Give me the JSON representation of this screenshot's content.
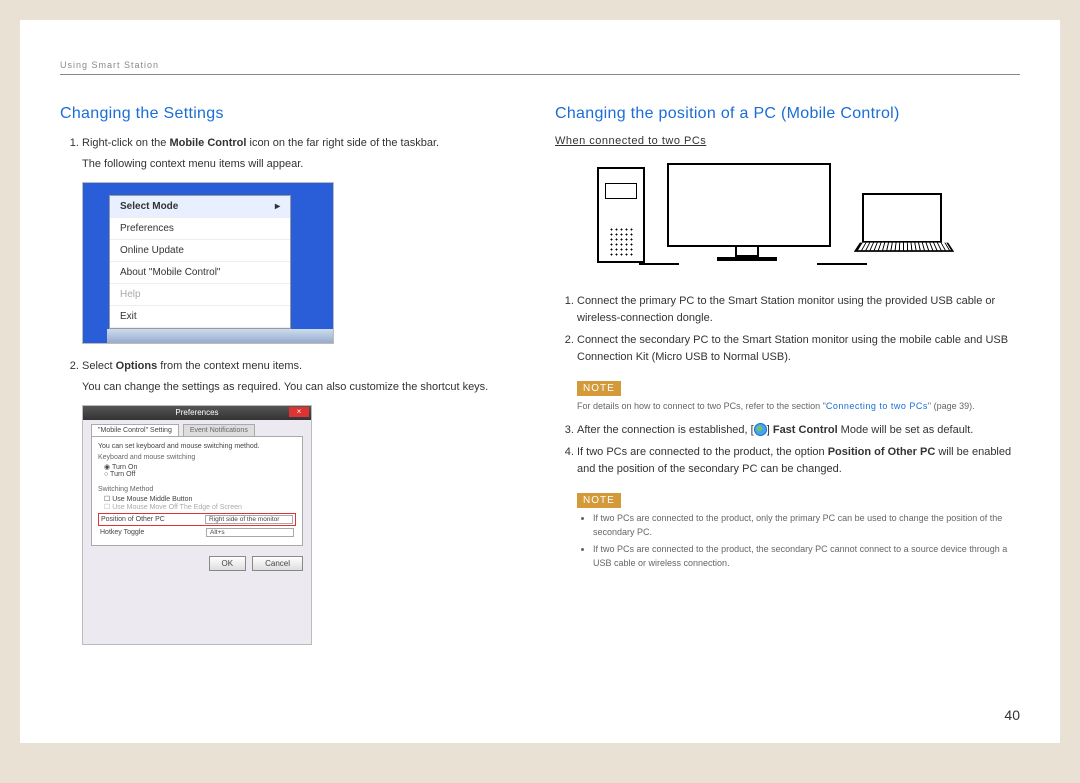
{
  "header": "Using Smart Station",
  "page_number": "40",
  "left": {
    "title": "Changing the Settings",
    "step1_pre": "Right-click on the ",
    "step1_bold": "Mobile Control",
    "step1_post": " icon on the far right side of the taskbar.",
    "step1_sub": "The following context menu items will appear.",
    "menu": {
      "select_mode": "Select Mode",
      "preferences": "Preferences",
      "online_update": "Online Update",
      "about": "About \"Mobile Control\"",
      "help": "Help",
      "exit": "Exit"
    },
    "step2_pre": "Select ",
    "step2_bold": "Options",
    "step2_post": " from the context menu items.",
    "step2_sub": "You can change the settings as required. You can also customize the shortcut keys.",
    "prefs": {
      "title": "Preferences",
      "tab1": "\"Mobile Control\" Setting",
      "tab2": "Event Notifications",
      "desc": "You can set keyboard and mouse switching method.",
      "group1": "Keyboard and mouse switching",
      "radio_on": "Turn On",
      "radio_off": "Turn Off",
      "group2": "Switching Method",
      "chk1": "Use Mouse Middle Button",
      "chk2": "Use Mouse Move Off The Edge of Screen",
      "pos_label": "Position of Other PC",
      "pos_value": "Right side of the monitor",
      "hotkey_label": "Hotkey Toggle",
      "hotkey_value": "Alt+s",
      "ok": "OK",
      "cancel": "Cancel"
    }
  },
  "right": {
    "title": "Changing the position of a PC (Mobile Control)",
    "subhead": "When connected to two PCs",
    "step1": "Connect the primary PC to the Smart Station monitor using the provided USB cable or wireless-connection dongle.",
    "step2": "Connect the secondary PC to the Smart Station monitor using the mobile cable and USB Connection Kit (Micro USB to Normal USB).",
    "note1_badge": "NOTE",
    "note1_text_pre": "For details on how to connect to two PCs, refer to the section \"",
    "note1_link": "Connecting to two PCs",
    "note1_text_post": "\" (page 39).",
    "step3_pre": "After the connection is established, [",
    "step3_mid": "] ",
    "step3_bold": "Fast Control",
    "step3_post": " Mode will be set as default.",
    "step4_pre": "If two PCs are connected to the product, the option ",
    "step4_bold": "Position of Other PC",
    "step4_post": " will be enabled and the position of the secondary PC can be changed.",
    "note2_badge": "NOTE",
    "note2_b1": "If two PCs are connected to the product, only the primary PC can be used to change the position of the secondary PC.",
    "note2_b2": "If two PCs are connected to the product, the secondary PC cannot connect to a source device through a USB cable or wireless connection."
  }
}
